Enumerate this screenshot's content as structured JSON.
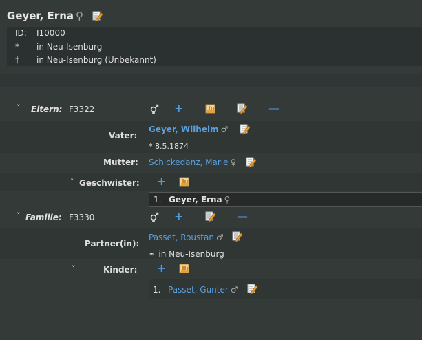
{
  "person": {
    "name": "Geyer, Erna",
    "gender_symbol": "♀",
    "id_label": "ID:",
    "id_value": "I10000",
    "birth_symbol": "*",
    "birth_place": "in Neu-Isenburg",
    "death_symbol": "†",
    "death_place": "in Neu-Isenburg (Unbekannt)"
  },
  "parents": {
    "label": "Eltern:",
    "family_id": "F3322",
    "father_label": "Vater:",
    "father_name": "Geyer, Wilhelm",
    "father_symbol": "♂",
    "father_birth": "* 8.5.1874",
    "mother_label": "Mutter:",
    "mother_name": "Schickedanz, Marie",
    "mother_symbol": "♀",
    "siblings_label": "Geschwister:",
    "siblings": [
      {
        "index": "1.",
        "name": "Geyer, Erna",
        "symbol": "♀"
      }
    ]
  },
  "family": {
    "label": "Familie:",
    "family_id": "F3330",
    "partner_label": "Partner(in):",
    "partner_name": "Passet, Roustan",
    "partner_symbol": "♂",
    "marriage_symbol": "⚭",
    "marriage_place": "in Neu-Isenburg",
    "children_label": "Kinder:",
    "children": [
      {
        "index": "1.",
        "name": "Passet, Gunter",
        "symbol": "♂"
      }
    ]
  },
  "icons": {
    "chevron": "˅",
    "plus": "+",
    "minus": "—",
    "gender": "⚦"
  },
  "colors": {
    "link": "#5b9fdc",
    "accent": "#4f9be6",
    "background": "#333a38"
  }
}
